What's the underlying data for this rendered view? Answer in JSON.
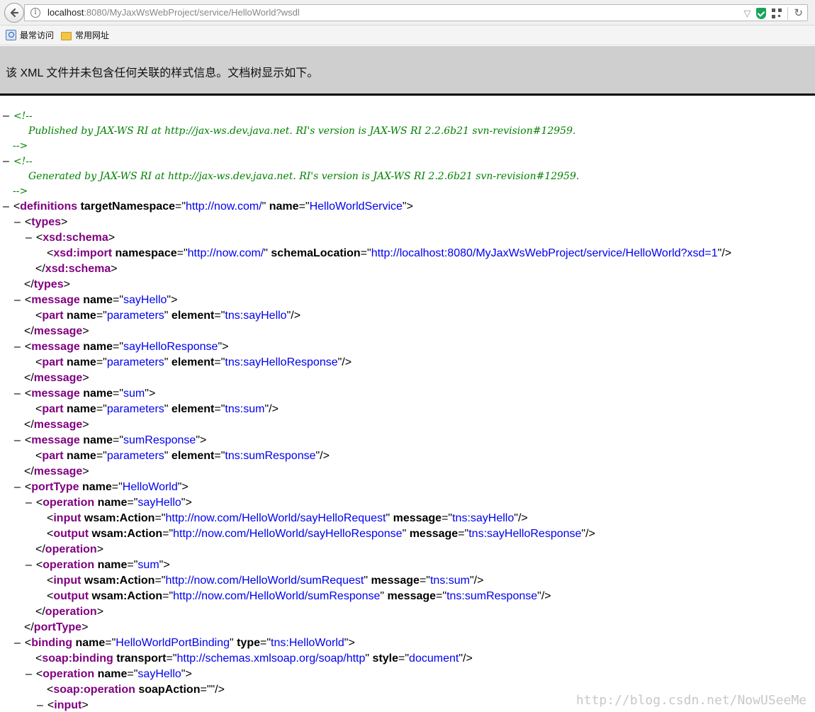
{
  "browser": {
    "url_host": "localhost",
    "url_rest": ":8080/MyJaxWsWebProject/service/HelloWorld?wsdl",
    "bookmarks": [
      "最常访问",
      "常用网址"
    ],
    "icons": [
      "back-arrow-icon",
      "info-icon",
      "dropdown-icon",
      "shield-icon",
      "qr-code-icon",
      "refresh-icon"
    ]
  },
  "notice": "该 XML 文件并未包含任何关联的样式信息。文档树显示如下。",
  "comments": [
    {
      "open": "<!--",
      "body": "Published by JAX-WS RI at http://jax-ws.dev.java.net. RI's version is JAX-WS RI 2.2.6b21  svn-revision#12959.",
      "close": "-->"
    },
    {
      "open": "<!--",
      "body": "Generated by JAX-WS RI at http://jax-ws.dev.java.net. RI's version is JAX-WS RI 2.2.6b21  svn-revision#12959.",
      "close": "-->"
    }
  ],
  "xml_lines": [
    {
      "col": 0,
      "toggle": "–",
      "parts": [
        [
          "mk",
          "<"
        ],
        [
          "tg",
          "definitions"
        ],
        [
          "at",
          " targetNamespace"
        ],
        [
          "mk",
          "=\""
        ],
        [
          "av",
          "http://now.com/"
        ],
        [
          "mk",
          "\""
        ],
        [
          "at",
          " name"
        ],
        [
          "mk",
          "=\""
        ],
        [
          "av",
          "HelloWorldService"
        ],
        [
          "mk",
          "\">"
        ]
      ]
    },
    {
      "col": 1,
      "toggle": "–",
      "parts": [
        [
          "mk",
          "<"
        ],
        [
          "tg",
          "types"
        ],
        [
          "mk",
          ">"
        ]
      ]
    },
    {
      "col": 2,
      "toggle": "–",
      "parts": [
        [
          "mk",
          "<"
        ],
        [
          "tg",
          "xsd:schema"
        ],
        [
          "mk",
          ">"
        ]
      ]
    },
    {
      "col": 3,
      "toggle": "",
      "parts": [
        [
          "mk",
          "<"
        ],
        [
          "tg",
          "xsd:import"
        ],
        [
          "at",
          " namespace"
        ],
        [
          "mk",
          "=\""
        ],
        [
          "av",
          "http://now.com/"
        ],
        [
          "mk",
          "\""
        ],
        [
          "at",
          " schemaLocation"
        ],
        [
          "mk",
          "=\""
        ],
        [
          "av",
          "http://localhost:8080/MyJaxWsWebProject/service/HelloWorld?xsd=1"
        ],
        [
          "mk",
          "\"/>"
        ]
      ]
    },
    {
      "col": 2,
      "toggle": "",
      "parts": [
        [
          "mk",
          "</"
        ],
        [
          "tg",
          "xsd:schema"
        ],
        [
          "mk",
          ">"
        ]
      ]
    },
    {
      "col": 1,
      "toggle": "",
      "parts": [
        [
          "mk",
          "</"
        ],
        [
          "tg",
          "types"
        ],
        [
          "mk",
          ">"
        ]
      ]
    },
    {
      "col": 1,
      "toggle": "–",
      "parts": [
        [
          "mk",
          "<"
        ],
        [
          "tg",
          "message"
        ],
        [
          "at",
          " name"
        ],
        [
          "mk",
          "=\""
        ],
        [
          "av",
          "sayHello"
        ],
        [
          "mk",
          "\">"
        ]
      ]
    },
    {
      "col": 2,
      "toggle": "",
      "parts": [
        [
          "mk",
          "<"
        ],
        [
          "tg",
          "part"
        ],
        [
          "at",
          " name"
        ],
        [
          "mk",
          "=\""
        ],
        [
          "av",
          "parameters"
        ],
        [
          "mk",
          "\""
        ],
        [
          "at",
          " element"
        ],
        [
          "mk",
          "=\""
        ],
        [
          "av",
          "tns:sayHello"
        ],
        [
          "mk",
          "\"/>"
        ]
      ]
    },
    {
      "col": 1,
      "toggle": "",
      "parts": [
        [
          "mk",
          "</"
        ],
        [
          "tg",
          "message"
        ],
        [
          "mk",
          ">"
        ]
      ]
    },
    {
      "col": 1,
      "toggle": "–",
      "parts": [
        [
          "mk",
          "<"
        ],
        [
          "tg",
          "message"
        ],
        [
          "at",
          " name"
        ],
        [
          "mk",
          "=\""
        ],
        [
          "av",
          "sayHelloResponse"
        ],
        [
          "mk",
          "\">"
        ]
      ]
    },
    {
      "col": 2,
      "toggle": "",
      "parts": [
        [
          "mk",
          "<"
        ],
        [
          "tg",
          "part"
        ],
        [
          "at",
          " name"
        ],
        [
          "mk",
          "=\""
        ],
        [
          "av",
          "parameters"
        ],
        [
          "mk",
          "\""
        ],
        [
          "at",
          " element"
        ],
        [
          "mk",
          "=\""
        ],
        [
          "av",
          "tns:sayHelloResponse"
        ],
        [
          "mk",
          "\"/>"
        ]
      ]
    },
    {
      "col": 1,
      "toggle": "",
      "parts": [
        [
          "mk",
          "</"
        ],
        [
          "tg",
          "message"
        ],
        [
          "mk",
          ">"
        ]
      ]
    },
    {
      "col": 1,
      "toggle": "–",
      "parts": [
        [
          "mk",
          "<"
        ],
        [
          "tg",
          "message"
        ],
        [
          "at",
          " name"
        ],
        [
          "mk",
          "=\""
        ],
        [
          "av",
          "sum"
        ],
        [
          "mk",
          "\">"
        ]
      ]
    },
    {
      "col": 2,
      "toggle": "",
      "parts": [
        [
          "mk",
          "<"
        ],
        [
          "tg",
          "part"
        ],
        [
          "at",
          " name"
        ],
        [
          "mk",
          "=\""
        ],
        [
          "av",
          "parameters"
        ],
        [
          "mk",
          "\""
        ],
        [
          "at",
          " element"
        ],
        [
          "mk",
          "=\""
        ],
        [
          "av",
          "tns:sum"
        ],
        [
          "mk",
          "\"/>"
        ]
      ]
    },
    {
      "col": 1,
      "toggle": "",
      "parts": [
        [
          "mk",
          "</"
        ],
        [
          "tg",
          "message"
        ],
        [
          "mk",
          ">"
        ]
      ]
    },
    {
      "col": 1,
      "toggle": "–",
      "parts": [
        [
          "mk",
          "<"
        ],
        [
          "tg",
          "message"
        ],
        [
          "at",
          " name"
        ],
        [
          "mk",
          "=\""
        ],
        [
          "av",
          "sumResponse"
        ],
        [
          "mk",
          "\">"
        ]
      ]
    },
    {
      "col": 2,
      "toggle": "",
      "parts": [
        [
          "mk",
          "<"
        ],
        [
          "tg",
          "part"
        ],
        [
          "at",
          " name"
        ],
        [
          "mk",
          "=\""
        ],
        [
          "av",
          "parameters"
        ],
        [
          "mk",
          "\""
        ],
        [
          "at",
          " element"
        ],
        [
          "mk",
          "=\""
        ],
        [
          "av",
          "tns:sumResponse"
        ],
        [
          "mk",
          "\"/>"
        ]
      ]
    },
    {
      "col": 1,
      "toggle": "",
      "parts": [
        [
          "mk",
          "</"
        ],
        [
          "tg",
          "message"
        ],
        [
          "mk",
          ">"
        ]
      ]
    },
    {
      "col": 1,
      "toggle": "–",
      "parts": [
        [
          "mk",
          "<"
        ],
        [
          "tg",
          "portType"
        ],
        [
          "at",
          " name"
        ],
        [
          "mk",
          "=\""
        ],
        [
          "av",
          "HelloWorld"
        ],
        [
          "mk",
          "\">"
        ]
      ]
    },
    {
      "col": 2,
      "toggle": "–",
      "parts": [
        [
          "mk",
          "<"
        ],
        [
          "tg",
          "operation"
        ],
        [
          "at",
          " name"
        ],
        [
          "mk",
          "=\""
        ],
        [
          "av",
          "sayHello"
        ],
        [
          "mk",
          "\">"
        ]
      ]
    },
    {
      "col": 3,
      "toggle": "",
      "parts": [
        [
          "mk",
          "<"
        ],
        [
          "tg",
          "input"
        ],
        [
          "at",
          " wsam:Action"
        ],
        [
          "mk",
          "=\""
        ],
        [
          "av",
          "http://now.com/HelloWorld/sayHelloRequest"
        ],
        [
          "mk",
          "\""
        ],
        [
          "at",
          " message"
        ],
        [
          "mk",
          "=\""
        ],
        [
          "av",
          "tns:sayHello"
        ],
        [
          "mk",
          "\"/>"
        ]
      ]
    },
    {
      "col": 3,
      "toggle": "",
      "parts": [
        [
          "mk",
          "<"
        ],
        [
          "tg",
          "output"
        ],
        [
          "at",
          " wsam:Action"
        ],
        [
          "mk",
          "=\""
        ],
        [
          "av",
          "http://now.com/HelloWorld/sayHelloResponse"
        ],
        [
          "mk",
          "\""
        ],
        [
          "at",
          " message"
        ],
        [
          "mk",
          "=\""
        ],
        [
          "av",
          "tns:sayHelloResponse"
        ],
        [
          "mk",
          "\"/>"
        ]
      ]
    },
    {
      "col": 2,
      "toggle": "",
      "parts": [
        [
          "mk",
          "</"
        ],
        [
          "tg",
          "operation"
        ],
        [
          "mk",
          ">"
        ]
      ]
    },
    {
      "col": 2,
      "toggle": "–",
      "parts": [
        [
          "mk",
          "<"
        ],
        [
          "tg",
          "operation"
        ],
        [
          "at",
          " name"
        ],
        [
          "mk",
          "=\""
        ],
        [
          "av",
          "sum"
        ],
        [
          "mk",
          "\">"
        ]
      ]
    },
    {
      "col": 3,
      "toggle": "",
      "parts": [
        [
          "mk",
          "<"
        ],
        [
          "tg",
          "input"
        ],
        [
          "at",
          " wsam:Action"
        ],
        [
          "mk",
          "=\""
        ],
        [
          "av",
          "http://now.com/HelloWorld/sumRequest"
        ],
        [
          "mk",
          "\""
        ],
        [
          "at",
          " message"
        ],
        [
          "mk",
          "=\""
        ],
        [
          "av",
          "tns:sum"
        ],
        [
          "mk",
          "\"/>"
        ]
      ]
    },
    {
      "col": 3,
      "toggle": "",
      "parts": [
        [
          "mk",
          "<"
        ],
        [
          "tg",
          "output"
        ],
        [
          "at",
          " wsam:Action"
        ],
        [
          "mk",
          "=\""
        ],
        [
          "av",
          "http://now.com/HelloWorld/sumResponse"
        ],
        [
          "mk",
          "\""
        ],
        [
          "at",
          " message"
        ],
        [
          "mk",
          "=\""
        ],
        [
          "av",
          "tns:sumResponse"
        ],
        [
          "mk",
          "\"/>"
        ]
      ]
    },
    {
      "col": 2,
      "toggle": "",
      "parts": [
        [
          "mk",
          "</"
        ],
        [
          "tg",
          "operation"
        ],
        [
          "mk",
          ">"
        ]
      ]
    },
    {
      "col": 1,
      "toggle": "",
      "parts": [
        [
          "mk",
          "</"
        ],
        [
          "tg",
          "portType"
        ],
        [
          "mk",
          ">"
        ]
      ]
    },
    {
      "col": 1,
      "toggle": "–",
      "parts": [
        [
          "mk",
          "<"
        ],
        [
          "tg",
          "binding"
        ],
        [
          "at",
          " name"
        ],
        [
          "mk",
          "=\""
        ],
        [
          "av",
          "HelloWorldPortBinding"
        ],
        [
          "mk",
          "\""
        ],
        [
          "at",
          " type"
        ],
        [
          "mk",
          "=\""
        ],
        [
          "av",
          "tns:HelloWorld"
        ],
        [
          "mk",
          "\">"
        ]
      ]
    },
    {
      "col": 2,
      "toggle": "",
      "parts": [
        [
          "mk",
          "<"
        ],
        [
          "tg",
          "soap:binding"
        ],
        [
          "at",
          " transport"
        ],
        [
          "mk",
          "=\""
        ],
        [
          "av",
          "http://schemas.xmlsoap.org/soap/http"
        ],
        [
          "mk",
          "\""
        ],
        [
          "at",
          " style"
        ],
        [
          "mk",
          "=\""
        ],
        [
          "av",
          "document"
        ],
        [
          "mk",
          "\"/>"
        ]
      ]
    },
    {
      "col": 2,
      "toggle": "–",
      "parts": [
        [
          "mk",
          "<"
        ],
        [
          "tg",
          "operation"
        ],
        [
          "at",
          " name"
        ],
        [
          "mk",
          "=\""
        ],
        [
          "av",
          "sayHello"
        ],
        [
          "mk",
          "\">"
        ]
      ]
    },
    {
      "col": 3,
      "toggle": "",
      "parts": [
        [
          "mk",
          "<"
        ],
        [
          "tg",
          "soap:operation"
        ],
        [
          "at",
          " soapAction"
        ],
        [
          "mk",
          "=\"\"/>"
        ]
      ]
    },
    {
      "col": 3,
      "toggle": "–",
      "parts": [
        [
          "mk",
          "<"
        ],
        [
          "tg",
          "input"
        ],
        [
          "mk",
          ">"
        ]
      ]
    }
  ],
  "watermark": "http://blog.csdn.net/NowUSeeMe"
}
